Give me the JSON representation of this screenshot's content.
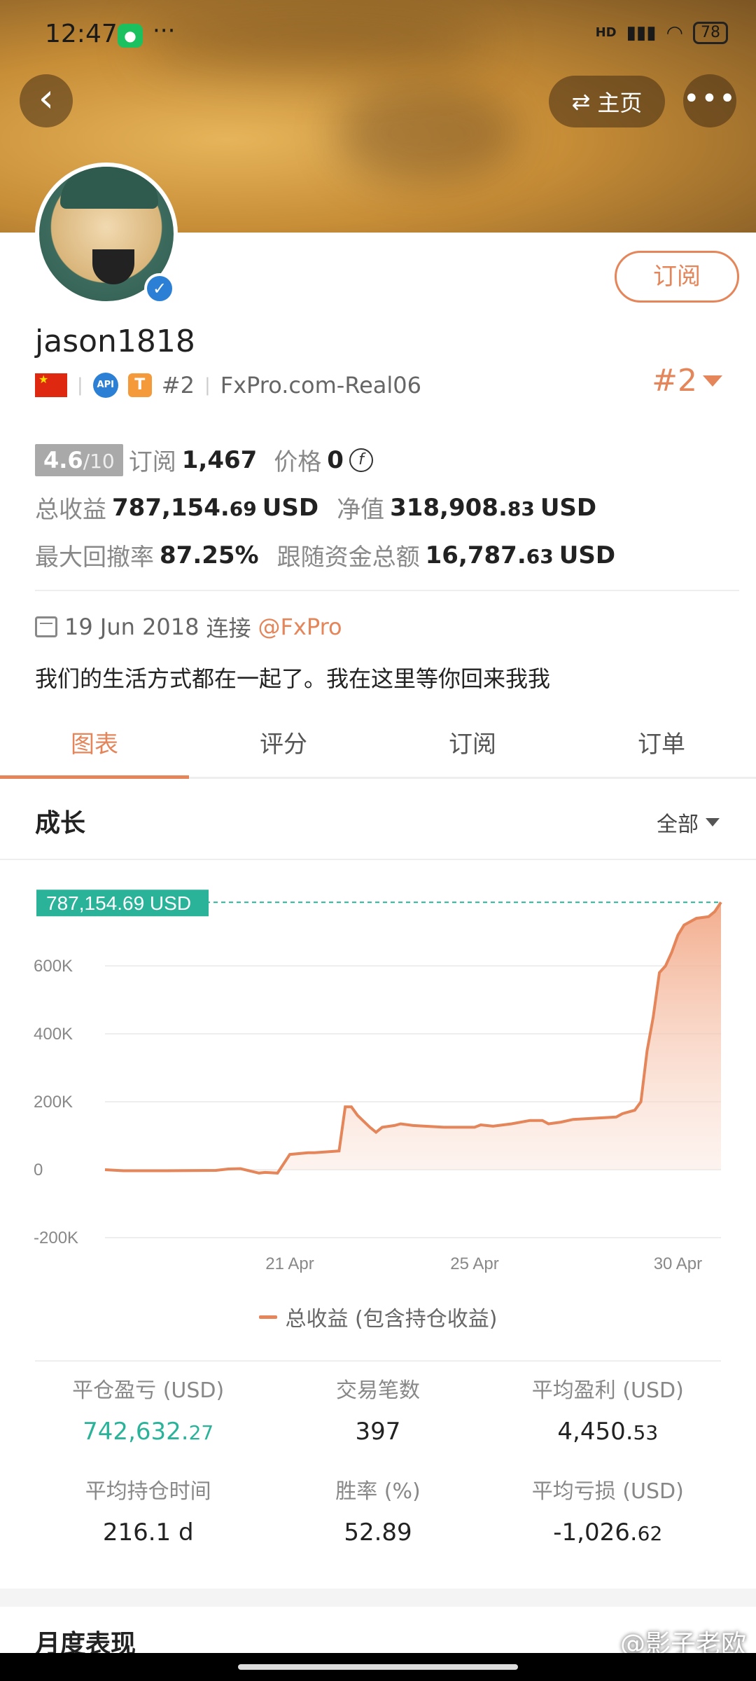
{
  "status_bar": {
    "time": "12:47",
    "network": "HD",
    "battery": "78"
  },
  "header": {
    "home_label": "主页"
  },
  "profile": {
    "username": "jason1818",
    "rank_small": "#2",
    "account": "FxPro.com-Real06",
    "rank_big": "#2",
    "subscribe_label": "订阅",
    "api_badge": "API",
    "t_badge": "T"
  },
  "stats": {
    "score": "4.6",
    "score_max": "/10",
    "subscribers_label": "订阅",
    "subscribers": "1,467",
    "price_label": "价格",
    "price": "0",
    "total_profit_label": "总收益",
    "total_profit_int": "787,154.",
    "total_profit_dec": "69",
    "total_profit_unit": "USD",
    "equity_label": "净值",
    "equity_int": "318,908.",
    "equity_dec": "83",
    "equity_unit": "USD",
    "max_drawdown_label": "最大回撤率",
    "max_drawdown": "87.25%",
    "follow_funds_label": "跟随资金总额",
    "follow_funds_int": "16,787.",
    "follow_funds_dec": "63",
    "follow_funds_unit": "USD"
  },
  "joined": {
    "date": "19 Jun 2018",
    "connect_label": "连接",
    "broker": "@FxPro"
  },
  "bio": "我们的生活方式都在一起了。我在这里等你回来我我",
  "tabs": [
    "图表",
    "评分",
    "订阅",
    "订单"
  ],
  "chart_section": {
    "title": "成长",
    "filter": "全部"
  },
  "chart_data": {
    "type": "area",
    "current_label": "787,154.69 USD",
    "y_ticks": [
      "600K",
      "400K",
      "200K",
      "0",
      "-200K"
    ],
    "x_ticks": [
      "21 Apr",
      "25 Apr",
      "30 Apr"
    ],
    "ylim": [
      -200000,
      800000
    ],
    "legend": "总收益 (包含持仓收益)",
    "x": [
      0,
      0.03,
      0.1,
      0.18,
      0.2,
      0.22,
      0.25,
      0.26,
      0.28,
      0.3,
      0.33,
      0.34,
      0.38,
      0.39,
      0.4,
      0.41,
      0.43,
      0.44,
      0.45,
      0.47,
      0.48,
      0.5,
      0.55,
      0.6,
      0.61,
      0.63,
      0.66,
      0.69,
      0.71,
      0.72,
      0.74,
      0.76,
      0.8,
      0.83,
      0.84,
      0.86,
      0.87,
      0.88,
      0.89,
      0.9,
      0.91,
      0.92,
      0.93,
      0.94,
      0.96,
      0.98,
      0.99,
      1.0
    ],
    "values": [
      0,
      -3000,
      -3000,
      -2000,
      2000,
      3000,
      -10000,
      -8000,
      -10000,
      45000,
      50000,
      50000,
      55000,
      185000,
      185000,
      160000,
      125000,
      110000,
      125000,
      130000,
      135000,
      130000,
      125000,
      125000,
      132000,
      128000,
      135000,
      145000,
      145000,
      135000,
      140000,
      148000,
      152000,
      155000,
      165000,
      175000,
      200000,
      350000,
      450000,
      580000,
      600000,
      640000,
      690000,
      720000,
      740000,
      745000,
      760000,
      787154
    ]
  },
  "summary": [
    [
      {
        "label": "平仓盈亏 (USD)",
        "int": "742,632.",
        "dec": "27",
        "color": "#2bb39a"
      },
      {
        "label": "交易笔数",
        "int": "397",
        "dec": ""
      },
      {
        "label": "平均盈利 (USD)",
        "int": "4,450.",
        "dec": "53"
      }
    ],
    [
      {
        "label": "平均持仓时间",
        "int": "216.1 d",
        "dec": ""
      },
      {
        "label": "胜率 (%)",
        "int": "52.89",
        "dec": ""
      },
      {
        "label": "平均亏损 (USD)",
        "int": "-1,026.",
        "dec": "62"
      }
    ]
  ],
  "monthly_title": "月度表现",
  "watermark": "@影子老欧",
  "colors": {
    "accent": "#e4855a",
    "green": "#2bb39a"
  }
}
